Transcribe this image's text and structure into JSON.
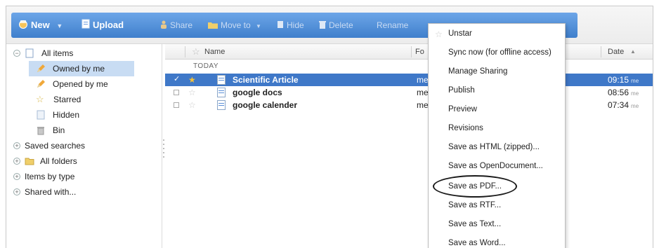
{
  "toolbar": {
    "new_label": "New",
    "upload_label": "Upload",
    "share_label": "Share",
    "move_to_label": "Move to",
    "hide_label": "Hide",
    "delete_label": "Delete",
    "rename_label": "Rename"
  },
  "sidebar": {
    "items": [
      {
        "label": "All items"
      },
      {
        "label": "Owned by me"
      },
      {
        "label": "Opened by me"
      },
      {
        "label": "Starred"
      },
      {
        "label": "Hidden"
      },
      {
        "label": "Bin"
      },
      {
        "label": "Saved searches"
      },
      {
        "label": "All folders"
      },
      {
        "label": "Items by type"
      },
      {
        "label": "Shared with..."
      }
    ],
    "selected": "Owned by me"
  },
  "list": {
    "columns": {
      "name": "Name",
      "folder": "Fo",
      "date": "Date"
    },
    "group_label": "TODAY",
    "rows": [
      {
        "name": "Scientific Article",
        "folder": "me",
        "date": "09:15",
        "owner": "me",
        "selected": true
      },
      {
        "name": "google docs",
        "folder": "me",
        "date": "08:56",
        "owner": "me",
        "selected": false
      },
      {
        "name": "google calender",
        "folder": "me",
        "date": "07:34",
        "owner": "me",
        "selected": false
      }
    ]
  },
  "context_menu": {
    "items": [
      {
        "label": "Unstar"
      },
      {
        "label": "Sync now (for offline access)"
      },
      {
        "label": "Manage Sharing"
      },
      {
        "label": "Publish"
      },
      {
        "label": "Preview"
      },
      {
        "label": "Revisions"
      },
      {
        "label": "Save as HTML (zipped)..."
      },
      {
        "label": "Save as OpenDocument..."
      },
      {
        "label": "Save as PDF..."
      },
      {
        "label": "Save as RTF..."
      },
      {
        "label": "Save as Text..."
      },
      {
        "label": "Save as Word..."
      }
    ],
    "highlighted": "Save as PDF..."
  },
  "colors": {
    "toolbar_blue": "#4a88d4",
    "selection_blue": "#3f78c8",
    "nav_selection": "#c8dcf3",
    "star_gold": "#f3c13a"
  }
}
